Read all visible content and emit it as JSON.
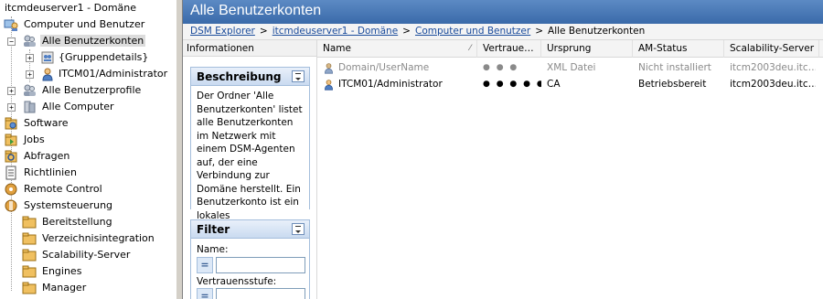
{
  "tree": {
    "root": "itcmdeuserver1 - Domäne",
    "items": [
      {
        "label": "Computer und Benutzer",
        "icon": "computer-users-icon"
      },
      {
        "label": "Alle Benutzerkonten",
        "icon": "users-icon"
      },
      {
        "label": "{Gruppendetails}",
        "icon": "group-icon"
      },
      {
        "label": "ITCM01/Administrator",
        "icon": "user-icon"
      },
      {
        "label": "Alle Benutzerprofile",
        "icon": "profiles-icon"
      },
      {
        "label": "Alle Computer",
        "icon": "computers-icon"
      },
      {
        "label": "Software",
        "icon": "software-icon"
      },
      {
        "label": "Jobs",
        "icon": "jobs-icon"
      },
      {
        "label": "Abfragen",
        "icon": "queries-icon"
      },
      {
        "label": "Richtlinien",
        "icon": "policies-icon"
      },
      {
        "label": "Remote Control",
        "icon": "remote-control-icon"
      },
      {
        "label": "Systemsteuerung",
        "icon": "control-panel-icon"
      },
      {
        "label": "Bereitstellung",
        "icon": "folder-icon"
      },
      {
        "label": "Verzeichnisintegration",
        "icon": "folder-icon"
      },
      {
        "label": "Scalability-Server",
        "icon": "folder-icon"
      },
      {
        "label": "Engines",
        "icon": "folder-icon"
      },
      {
        "label": "Manager",
        "icon": "folder-icon"
      }
    ]
  },
  "header": {
    "title": "Alle Benutzerkonten"
  },
  "breadcrumb": {
    "items": [
      "DSM Explorer",
      "itcmdeuserver1 - Domäne",
      "Computer und Benutzer"
    ],
    "current": "Alle Benutzerkonten",
    "separator": ">"
  },
  "info": {
    "header": "Informationen",
    "description": {
      "title": "Beschreibung",
      "text": "Der Ordner 'Alle Benutzerkonten' listet alle Benutzerkonten im Netzwerk mit einem DSM-Agenten auf, der eine Verbindung zur Domäne herstellt. Ein Benutzerkonto ist ein lokales Computerkonto oder ein Domänenkonto."
    },
    "filter": {
      "title": "Filter",
      "name_label": "Name:",
      "trust_label": "Vertrauensstufe:",
      "operator": "="
    }
  },
  "table": {
    "columns": [
      "Name",
      "Vertraue…",
      "Ursprung",
      "AM-Status",
      "Scalability-Server"
    ],
    "sort_indicator": "⁄",
    "rows": [
      {
        "name": "Domain/UserName",
        "trust": "● ● ●",
        "origin": "XML Datei",
        "am_status": "Nicht installiert",
        "server": "itcm2003deu.itc…",
        "disabled": true
      },
      {
        "name": "ITCM01/Administrator",
        "trust": "● ● ● ● ●",
        "origin": "CA",
        "am_status": "Betriebsbereit",
        "server": "itcm2003deu.itc…",
        "disabled": false
      }
    ]
  },
  "colors": {
    "title_bar": "#3a6aa9",
    "link": "#1a4b9b",
    "panel_bg": "#dce8f7"
  }
}
